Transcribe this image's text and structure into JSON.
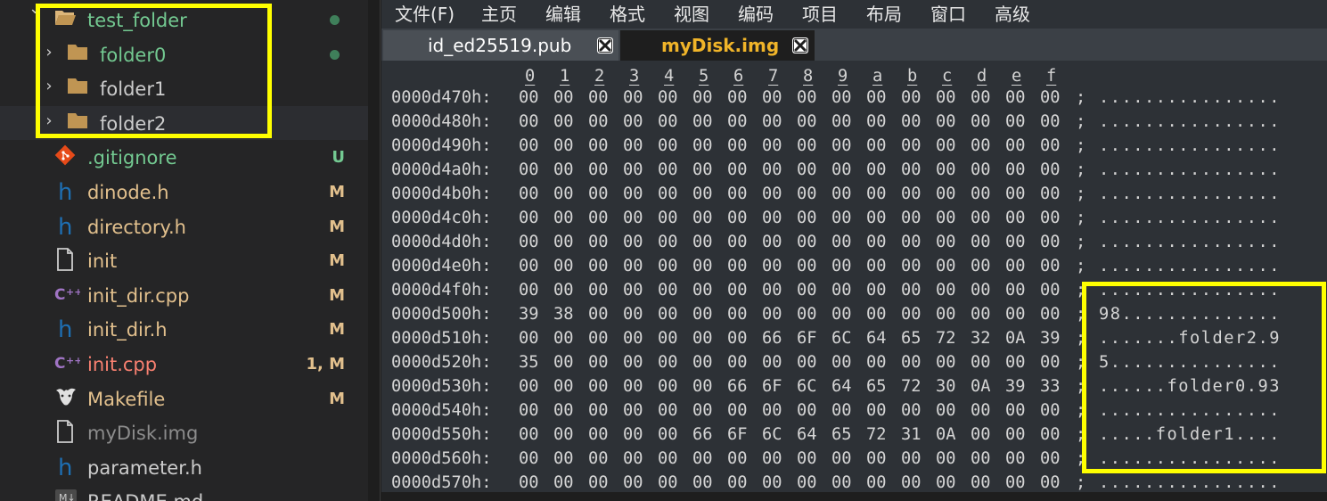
{
  "sidebar": {
    "tree": [
      {
        "name": "test_folder",
        "type": "folder-open",
        "indent": 1,
        "chevron": "v",
        "color": "#73c991",
        "status": "",
        "dot": true
      },
      {
        "name": "folder0",
        "type": "folder",
        "indent": 2,
        "chevron": ">",
        "color": "#73c991",
        "status": "",
        "dot": true
      },
      {
        "name": "folder1",
        "type": "folder",
        "indent": 2,
        "chevron": ">",
        "color": "#cccccc",
        "status": "",
        "dot": false
      },
      {
        "name": "folder2",
        "type": "folder",
        "indent": 2,
        "chevron": ">",
        "color": "#cccccc",
        "status": "",
        "dot": false,
        "hover": true
      },
      {
        "name": ".gitignore",
        "type": "git",
        "indent": 1,
        "color": "#73c991",
        "status": "U",
        "status_color": "#73c991"
      },
      {
        "name": "dinode.h",
        "type": "h",
        "indent": 1,
        "color": "#e2c08d",
        "status": "M",
        "status_color": "#e2c08d"
      },
      {
        "name": "directory.h",
        "type": "h",
        "indent": 1,
        "color": "#e2c08d",
        "status": "M",
        "status_color": "#e2c08d"
      },
      {
        "name": "init",
        "type": "file",
        "indent": 1,
        "color": "#e2c08d",
        "status": "M",
        "status_color": "#e2c08d"
      },
      {
        "name": "init_dir.cpp",
        "type": "cpp",
        "indent": 1,
        "color": "#e2c08d",
        "status": "M",
        "status_color": "#e2c08d"
      },
      {
        "name": "init_dir.h",
        "type": "h",
        "indent": 1,
        "color": "#e2c08d",
        "status": "M",
        "status_color": "#e2c08d"
      },
      {
        "name": "init.cpp",
        "type": "cpp",
        "indent": 1,
        "color": "#f88070",
        "status": "1, M",
        "status_color": "#e2c08d"
      },
      {
        "name": "Makefile",
        "type": "gnu",
        "indent": 1,
        "color": "#e2c08d",
        "status": "M",
        "status_color": "#e2c08d"
      },
      {
        "name": "myDisk.img",
        "type": "file",
        "indent": 1,
        "color": "#8c8c8c",
        "status": "",
        "dot": false
      },
      {
        "name": "parameter.h",
        "type": "h",
        "indent": 1,
        "color": "#cccccc",
        "status": ""
      },
      {
        "name": "README.md",
        "type": "md",
        "indent": 1,
        "color": "#cccccc",
        "status": ""
      }
    ]
  },
  "editor": {
    "menu": [
      "文件(F)",
      "主页",
      "编辑",
      "格式",
      "视图",
      "编码",
      "项目",
      "布局",
      "窗口",
      "高级"
    ],
    "tabs": [
      {
        "label": "id_ed25519.pub",
        "active": false
      },
      {
        "label": "myDisk.img",
        "active": true
      }
    ],
    "hex": {
      "columns": [
        "0",
        "1",
        "2",
        "3",
        "4",
        "5",
        "6",
        "7",
        "8",
        "9",
        "a",
        "b",
        "c",
        "d",
        "e",
        "f"
      ],
      "rows": [
        {
          "addr": "0000d470h:",
          "bytes": [
            "00",
            "00",
            "00",
            "00",
            "00",
            "00",
            "00",
            "00",
            "00",
            "00",
            "00",
            "00",
            "00",
            "00",
            "00",
            "00"
          ],
          "ascii": "................"
        },
        {
          "addr": "0000d480h:",
          "bytes": [
            "00",
            "00",
            "00",
            "00",
            "00",
            "00",
            "00",
            "00",
            "00",
            "00",
            "00",
            "00",
            "00",
            "00",
            "00",
            "00"
          ],
          "ascii": "................"
        },
        {
          "addr": "0000d490h:",
          "bytes": [
            "00",
            "00",
            "00",
            "00",
            "00",
            "00",
            "00",
            "00",
            "00",
            "00",
            "00",
            "00",
            "00",
            "00",
            "00",
            "00"
          ],
          "ascii": "................"
        },
        {
          "addr": "0000d4a0h:",
          "bytes": [
            "00",
            "00",
            "00",
            "00",
            "00",
            "00",
            "00",
            "00",
            "00",
            "00",
            "00",
            "00",
            "00",
            "00",
            "00",
            "00"
          ],
          "ascii": "................"
        },
        {
          "addr": "0000d4b0h:",
          "bytes": [
            "00",
            "00",
            "00",
            "00",
            "00",
            "00",
            "00",
            "00",
            "00",
            "00",
            "00",
            "00",
            "00",
            "00",
            "00",
            "00"
          ],
          "ascii": "................"
        },
        {
          "addr": "0000d4c0h:",
          "bytes": [
            "00",
            "00",
            "00",
            "00",
            "00",
            "00",
            "00",
            "00",
            "00",
            "00",
            "00",
            "00",
            "00",
            "00",
            "00",
            "00"
          ],
          "ascii": "................"
        },
        {
          "addr": "0000d4d0h:",
          "bytes": [
            "00",
            "00",
            "00",
            "00",
            "00",
            "00",
            "00",
            "00",
            "00",
            "00",
            "00",
            "00",
            "00",
            "00",
            "00",
            "00"
          ],
          "ascii": "................"
        },
        {
          "addr": "0000d4e0h:",
          "bytes": [
            "00",
            "00",
            "00",
            "00",
            "00",
            "00",
            "00",
            "00",
            "00",
            "00",
            "00",
            "00",
            "00",
            "00",
            "00",
            "00"
          ],
          "ascii": "................"
        },
        {
          "addr": "0000d4f0h:",
          "bytes": [
            "00",
            "00",
            "00",
            "00",
            "00",
            "00",
            "00",
            "00",
            "00",
            "00",
            "00",
            "00",
            "00",
            "00",
            "00",
            "00"
          ],
          "ascii": "................"
        },
        {
          "addr": "0000d500h:",
          "bytes": [
            "39",
            "38",
            "00",
            "00",
            "00",
            "00",
            "00",
            "00",
            "00",
            "00",
            "00",
            "00",
            "00",
            "00",
            "00",
            "00"
          ],
          "ascii": "98.............."
        },
        {
          "addr": "0000d510h:",
          "bytes": [
            "00",
            "00",
            "00",
            "00",
            "00",
            "00",
            "00",
            "66",
            "6F",
            "6C",
            "64",
            "65",
            "72",
            "32",
            "0A",
            "39"
          ],
          "ascii": ".......folder2.9"
        },
        {
          "addr": "0000d520h:",
          "bytes": [
            "35",
            "00",
            "00",
            "00",
            "00",
            "00",
            "00",
            "00",
            "00",
            "00",
            "00",
            "00",
            "00",
            "00",
            "00",
            "00"
          ],
          "ascii": "5..............."
        },
        {
          "addr": "0000d530h:",
          "bytes": [
            "00",
            "00",
            "00",
            "00",
            "00",
            "00",
            "66",
            "6F",
            "6C",
            "64",
            "65",
            "72",
            "30",
            "0A",
            "39",
            "33"
          ],
          "ascii": "......folder0.93"
        },
        {
          "addr": "0000d540h:",
          "bytes": [
            "00",
            "00",
            "00",
            "00",
            "00",
            "00",
            "00",
            "00",
            "00",
            "00",
            "00",
            "00",
            "00",
            "00",
            "00",
            "00"
          ],
          "ascii": "................"
        },
        {
          "addr": "0000d550h:",
          "bytes": [
            "00",
            "00",
            "00",
            "00",
            "00",
            "66",
            "6F",
            "6C",
            "64",
            "65",
            "72",
            "31",
            "0A",
            "00",
            "00",
            "00"
          ],
          "ascii": ".....folder1...."
        },
        {
          "addr": "0000d560h:",
          "bytes": [
            "00",
            "00",
            "00",
            "00",
            "00",
            "00",
            "00",
            "00",
            "00",
            "00",
            "00",
            "00",
            "00",
            "00",
            "00",
            "00"
          ],
          "ascii": "................"
        },
        {
          "addr": "0000d570h:",
          "bytes": [
            "00",
            "00",
            "00",
            "00",
            "00",
            "00",
            "00",
            "00",
            "00",
            "00",
            "00",
            "00",
            "00",
            "00",
            "00",
            "00"
          ],
          "ascii": "................"
        }
      ]
    }
  },
  "colors": {
    "highlight": "#ffff00",
    "sidebar_bg": "#252526",
    "editor_bg": "#2d3136",
    "active_tab_text": "#f0b429"
  }
}
